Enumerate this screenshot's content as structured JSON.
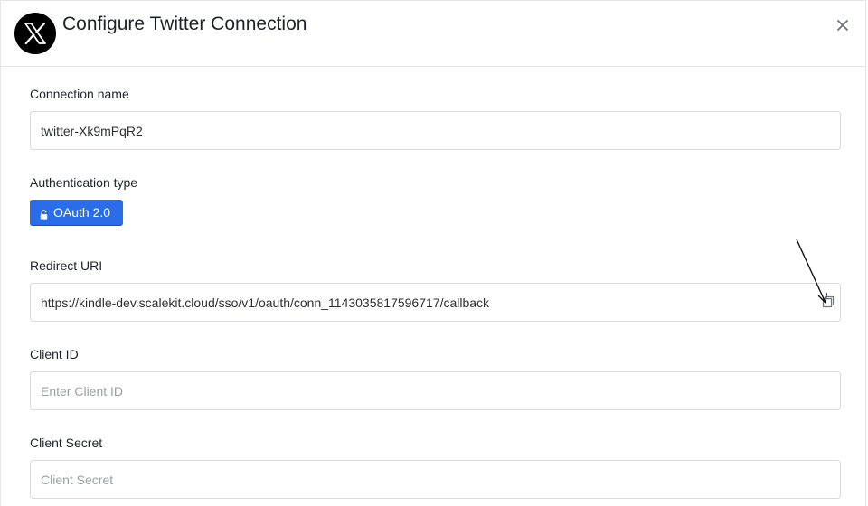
{
  "dialog": {
    "title": "Configure Twitter Connection",
    "logo_icon": "x-logo-icon",
    "close_icon": "close-icon"
  },
  "connection_name": {
    "label": "Connection name",
    "value": "twitter-Xk9mPqR2"
  },
  "auth_type": {
    "label": "Authentication type",
    "button_label": "OAuth 2.0",
    "button_icon": "lock-icon",
    "button_color": "#2b6de8"
  },
  "redirect_uri": {
    "label": "Redirect URI",
    "value": "https://kindle-dev.scalekit.cloud/sso/v1/oauth/conn_1143035817596717/callback",
    "copy_icon": "copy-icon"
  },
  "client_id": {
    "label": "Client ID",
    "placeholder": "Enter Client ID"
  },
  "client_secret": {
    "label": "Client Secret",
    "placeholder": "Client Secret"
  }
}
